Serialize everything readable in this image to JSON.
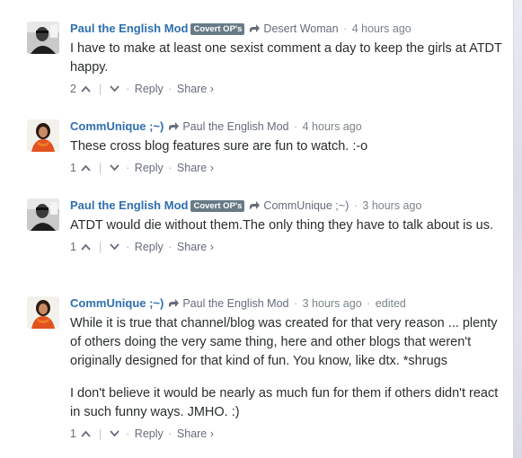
{
  "comments": [
    {
      "author": "Paul the English Mod",
      "badge": "Covert OP's",
      "in_reply_to": "Desert Woman",
      "time": "4 hours ago",
      "edited": "",
      "paragraphs": [
        "I have to make at least one sexist comment a day to keep the girls at ATDT happy."
      ],
      "votes": "2",
      "reply_label": "Reply",
      "share_label": "Share ›",
      "avatar": "bw-man-portrait"
    },
    {
      "author": "CommUnique ;~)",
      "badge": "",
      "in_reply_to": "Paul the English Mod",
      "time": "4 hours ago",
      "edited": "",
      "paragraphs": [
        "These cross blog features sure are fun to watch. :-o"
      ],
      "votes": "1",
      "reply_label": "Reply",
      "share_label": "Share ›",
      "avatar": "woman-orange-scarf"
    },
    {
      "author": "Paul the English Mod",
      "badge": "Covert OP's",
      "in_reply_to": "CommUnique ;~)",
      "time": "3 hours ago",
      "edited": "",
      "paragraphs": [
        "ATDT would die without them.The only thing they have to talk about is us."
      ],
      "votes": "1",
      "reply_label": "Reply",
      "share_label": "Share ›",
      "avatar": "bw-man-portrait"
    },
    {
      "author": "CommUnique ;~)",
      "badge": "",
      "in_reply_to": "Paul the English Mod",
      "time": "3 hours ago",
      "edited": "edited",
      "paragraphs": [
        "While it is true that channel/blog was created for that very reason ... plenty of others doing the very same thing, here and other blogs that weren't originally designed for that kind of fun. You know, like dtx. *shrugs",
        "I don't believe it would be nearly as much fun for them if others didn't react in such funny ways. JMHO. :)"
      ],
      "votes": "1",
      "reply_label": "Reply",
      "share_label": "Share ›",
      "avatar": "woman-orange-scarf"
    }
  ],
  "separator": "·",
  "colors": {
    "author": "#2e6fb0",
    "badge_bg": "#687a86",
    "meta": "#7a8489",
    "text": "#2a2e2e"
  }
}
